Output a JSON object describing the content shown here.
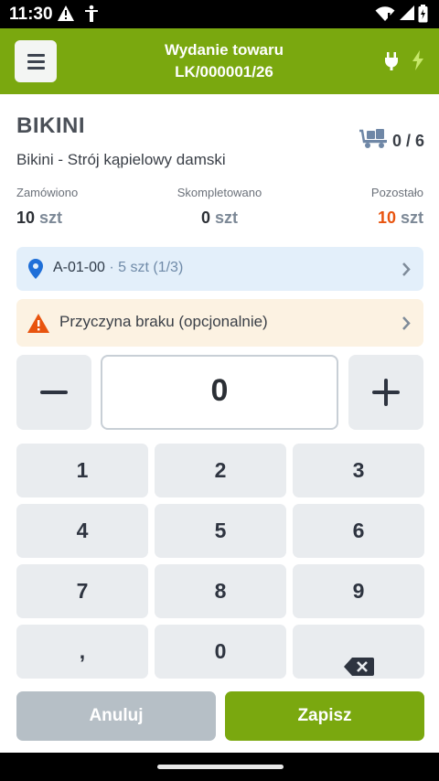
{
  "status_bar": {
    "time": "11:30"
  },
  "header": {
    "title_line1": "Wydanie towaru",
    "title_line2": "LK/000001/26"
  },
  "product": {
    "name": "BIKINI",
    "description": "Bikini - Strój kąpielowy damski",
    "pack_count": "0 / 6"
  },
  "stats": {
    "ordered": {
      "label": "Zamówiono",
      "value": "10",
      "unit": "szt"
    },
    "picked": {
      "label": "Skompletowano",
      "value": "0",
      "unit": "szt"
    },
    "remaining": {
      "label": "Pozostało",
      "value": "10",
      "unit": "szt"
    }
  },
  "location": {
    "code": "A-01-00",
    "qty_text": "· 5 szt (1/3)"
  },
  "shortage": {
    "label": "Przyczyna braku (opcjonalnie)"
  },
  "quantity": {
    "value": "0"
  },
  "keypad": {
    "keys": [
      "1",
      "2",
      "3",
      "4",
      "5",
      "6",
      "7",
      "8",
      "9",
      ",",
      "0",
      "backspace"
    ]
  },
  "actions": {
    "cancel_label": "Anuluj",
    "save_label": "Zapisz"
  },
  "colors": {
    "accent": "#7aa80f",
    "remaining": "#e8540f",
    "location_bg": "#e3effa",
    "warning_bg": "#fcf2e2",
    "warning_icon": "#e8540f",
    "pin": "#1f6fd8"
  }
}
